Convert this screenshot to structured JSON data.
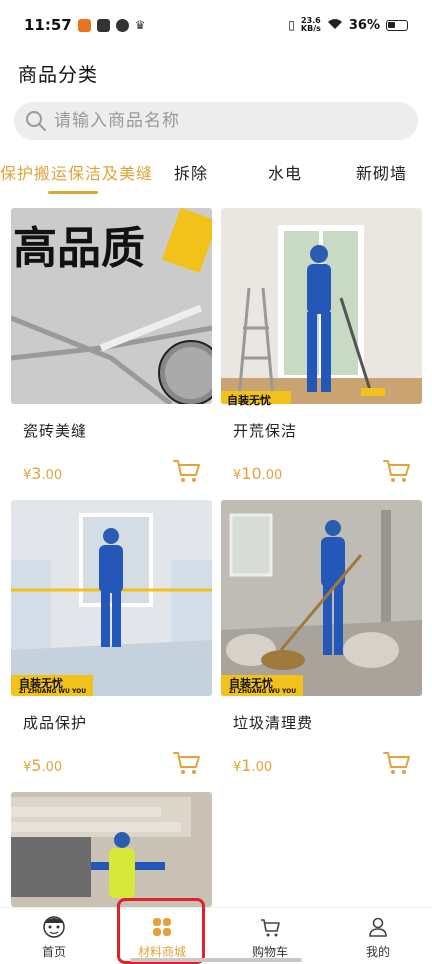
{
  "status_bar": {
    "time": "11:57",
    "speed_top": "23.6",
    "speed_bottom": "KB/s",
    "battery": "36%"
  },
  "header": {
    "title": "商品分类"
  },
  "search": {
    "placeholder": "请输入商品名称",
    "icon": "search-icon"
  },
  "tabs": [
    {
      "label": "保护搬运保洁及美缝",
      "active": true
    },
    {
      "label": "拆除"
    },
    {
      "label": "水电"
    },
    {
      "label": "新砌墙"
    }
  ],
  "accent_color": "#e0a43a",
  "products": [
    {
      "name": "瓷砖美缝",
      "currency": "¥",
      "price_int": "3",
      "price_dec": ".00",
      "image_text": "高品质"
    },
    {
      "name": "开荒保洁",
      "currency": "¥",
      "price_int": "10",
      "price_dec": ".00",
      "image_banner": "自装无忧"
    },
    {
      "name": "成品保护",
      "currency": "¥",
      "price_int": "5",
      "price_dec": ".00",
      "image_banner": "自装无忧",
      "image_banner_sub": "ZI ZHUANG WU YOU"
    },
    {
      "name": "垃圾清理费",
      "currency": "¥",
      "price_int": "1",
      "price_dec": ".00",
      "image_banner": "自装无忧",
      "image_banner_sub": "ZI ZHUANG WU YOU"
    }
  ],
  "bottom_nav": [
    {
      "label": "首页",
      "icon": "mascot-icon"
    },
    {
      "label": "材料商城",
      "icon": "grid-icon",
      "active": true
    },
    {
      "label": "购物车",
      "icon": "cart-icon"
    },
    {
      "label": "我的",
      "icon": "user-icon"
    }
  ]
}
